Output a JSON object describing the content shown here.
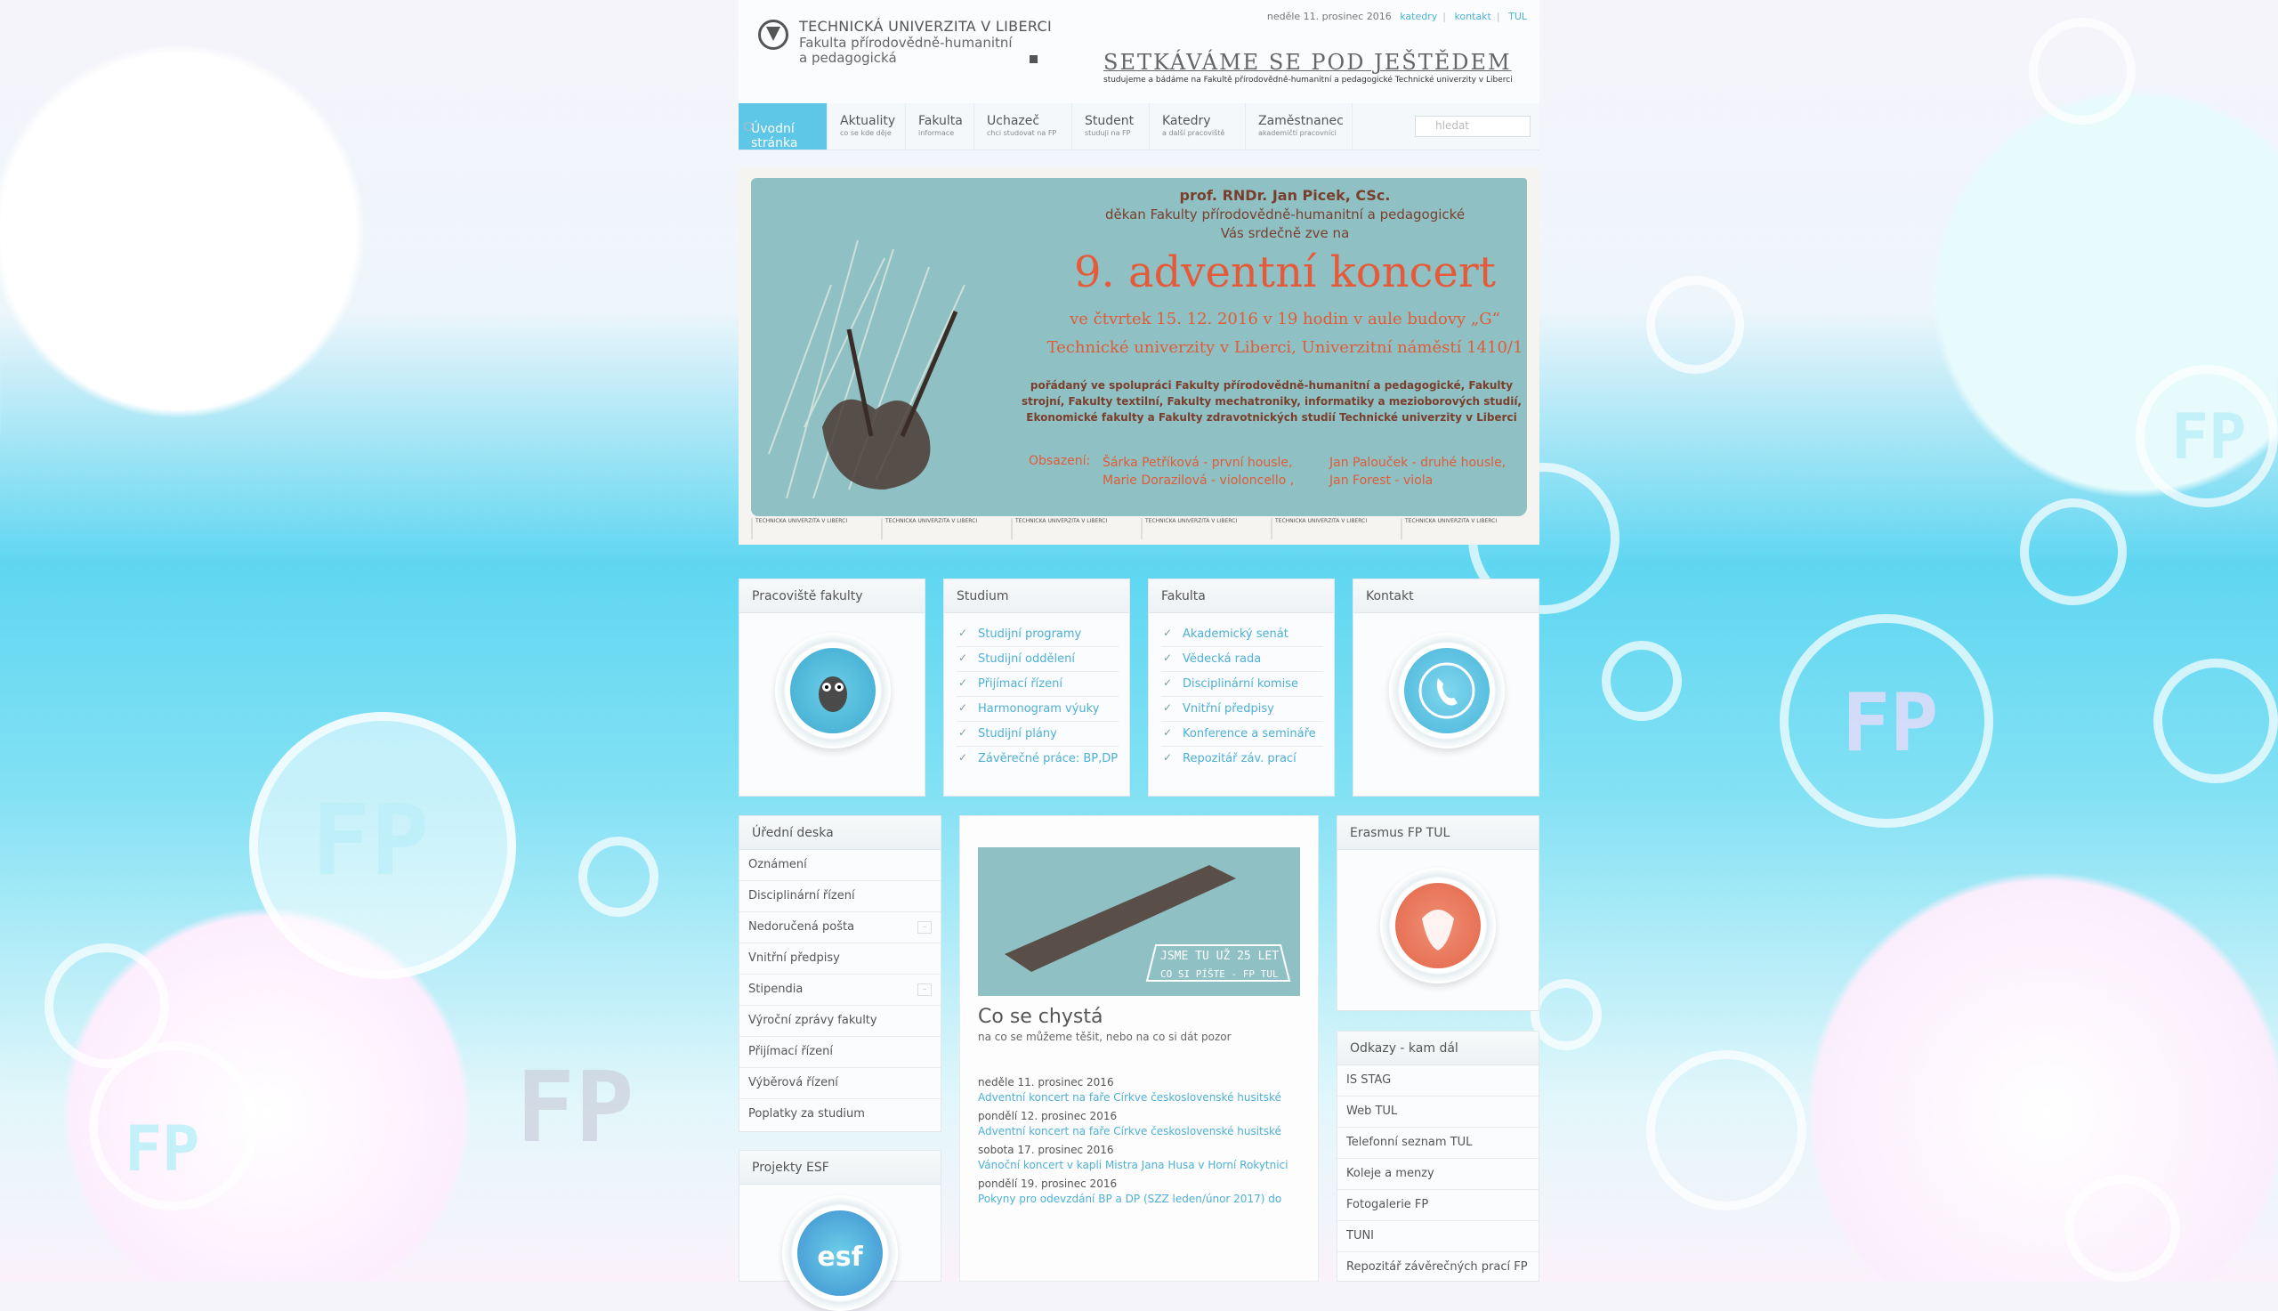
{
  "header": {
    "university": "TECHNICKÁ UNIVERZITA V LIBERCI",
    "faculty_line1": "Fakulta přírodovědně-humanitní",
    "faculty_line2": "a pedagogická",
    "date": "neděle 11. prosinec 2016",
    "links": [
      "katedry",
      "kontakt",
      "TUL"
    ],
    "slogan": "SETKÁVÁME SE POD JEŠTĚDEM",
    "slogan_sub": "studujeme a bádáme na Fakultě přírodovědně-humanitní a pedagogické Technické univerzity v Liberci"
  },
  "nav": {
    "items": [
      {
        "title": "Úvodní stránka",
        "sub": ""
      },
      {
        "title": "Aktuality",
        "sub": "co se kde děje"
      },
      {
        "title": "Fakulta",
        "sub": "informace"
      },
      {
        "title": "Uchazeč",
        "sub": "chci studovat na FP"
      },
      {
        "title": "Student",
        "sub": "studuji na FP"
      },
      {
        "title": "Katedry",
        "sub": "a další pracoviště"
      },
      {
        "title": "Zaměstnanec",
        "sub": "akademičtí pracovníci"
      }
    ],
    "search_placeholder": "hledat"
  },
  "banner": {
    "line1": "prof. RNDr. Jan Picek, CSc.",
    "line2": "děkan Fakulty přírodovědně-humanitní a pedagogické",
    "line3": "Vás srdečně zve na",
    "title": "9. adventní koncert",
    "line4": "ve čtvrtek 15. 12. 2016 v 19 hodin v aule budovy „G“",
    "line5": "Technické univerzity v Liberci, Univerzitní náměstí 1410/1",
    "para": "pořádaný ve spolupráci Fakulty přírodovědně-humanitní a pedagogické, Fakulty strojní, Fakulty textilní, Fakulty mechatroniky, informatiky a mezioborových studií, Ekonomické fakulty a Fakulty zdravotnických studií Technické univerzity v Liberci",
    "cast_label": "Obsazení:",
    "cast1a": "Šárka Petříková - první housle,",
    "cast1b": "Marie Dorazilová - violoncello ,",
    "cast2a": "Jan Palouček - druhé housle,",
    "cast2b": "Jan Forest - viola",
    "footer_logos": [
      "TECHNICKÁ UNIVERZITA V LIBERCI",
      "TECHNICKÁ UNIVERZITA V LIBERCI",
      "TECHNICKÁ UNIVERZITA V LIBERCI",
      "TECHNICKÁ UNIVERZITA V LIBERCI",
      "TECHNICKÁ UNIVERZITA V LIBERCI",
      "TECHNICKÁ UNIVERZITA V LIBERCI"
    ]
  },
  "boxes": {
    "pracoviste": {
      "title": "Pracoviště fakulty"
    },
    "studium": {
      "title": "Studium",
      "items": [
        "Studijní programy",
        "Studijní oddělení",
        "Přijímací řízení",
        "Harmonogram výuky",
        "Studijní plány",
        "Závěrečné práce: BP,DP"
      ]
    },
    "fakulta": {
      "title": "Fakulta",
      "items": [
        "Akademický senát",
        "Vědecká rada",
        "Disciplinární komise",
        "Vnitřní předpisy",
        "Konference a semináře",
        "Repozitář záv. prací"
      ]
    },
    "kontakt": {
      "title": "Kontakt"
    },
    "uredni": {
      "title": "Úřední deska",
      "items": [
        "Oznámení",
        "Disciplinární řízení",
        "Nedoručená pošta",
        "Vnitřní předpisy",
        "Stipendia",
        "Výroční zprávy fakulty",
        "Přijímací řízení",
        "Výběrová řízení",
        "Poplatky za studium"
      ]
    },
    "esf": {
      "title": "Projekty ESF"
    },
    "erasmus": {
      "title": "Erasmus FP TUL"
    },
    "odkazy": {
      "title": "Odkazy - kam dál",
      "items": [
        "IS STAG",
        "Web TUL",
        "Telefonní seznam TUL",
        "Koleje a menzy",
        "Fotogalerie FP",
        "TUNI",
        "Repozitář závěrečných prací FP"
      ]
    }
  },
  "news": {
    "image_text1": "JSME TU UŽ 25 LET",
    "image_text2": "CO SI PÍŠTE - FP TUL",
    "title": "Co se chystá",
    "subtitle": "na co se můžeme těšit, nebo na co si dát pozor",
    "events": [
      {
        "date": "neděle 11. prosinec 2016",
        "link": "Adventní koncert na faře Církve československé husitské"
      },
      {
        "date": "pondělí 12. prosinec 2016",
        "link": "Adventní koncert na faře Církve československé husitské"
      },
      {
        "date": "sobota 17. prosinec 2016",
        "link": "Vánoční koncert v kapli Mistra Jana Husa v Horní Rokytnici"
      },
      {
        "date": "pondělí 19. prosinec 2016",
        "link": "Pokyny pro odevzdání BP a DP (SZZ leden/únor 2017) do"
      }
    ]
  },
  "colors": {
    "accent": "#5ec6e7",
    "link": "#4db0d6",
    "banner_bg": "#8fc0c4",
    "banner_title": "#e55b3a"
  },
  "icons": [
    "owl-icon",
    "phone-icon",
    "erasmus-icon",
    "esf-icon",
    "check-icon",
    "search-icon"
  ]
}
